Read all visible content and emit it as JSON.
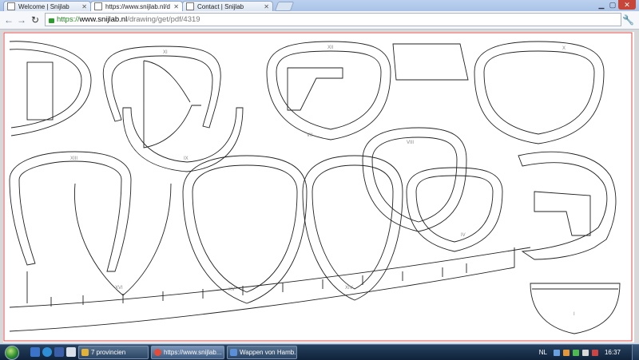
{
  "browser": {
    "tabs": [
      {
        "title": "Welcome | Snijlab",
        "active": false
      },
      {
        "title": "https://www.snijlab.nl/dr",
        "active": true
      },
      {
        "title": "Contact | Snijlab",
        "active": false
      }
    ],
    "url": {
      "scheme": "https://",
      "host": "www.snijlab.nl",
      "path": "/drawing/get/pdf/4319"
    }
  },
  "drawing": {
    "frame_color": "#e14a4a",
    "part_labels": [
      "XI",
      "IX",
      "XII",
      "VII",
      "X",
      "XIII",
      "VIII",
      "IV",
      "XVI",
      "XV",
      "XIV",
      "I"
    ]
  },
  "taskbar": {
    "tasks": [
      {
        "label": "7 provincien",
        "icon_color": "#e0b23a"
      },
      {
        "label": "https://www.snijlab...",
        "icon_color": "#e34b3a"
      },
      {
        "label": "Wappen von Hamb...",
        "icon_color": "#5b8fd8"
      }
    ],
    "language": "NL",
    "clock": "16:37"
  }
}
